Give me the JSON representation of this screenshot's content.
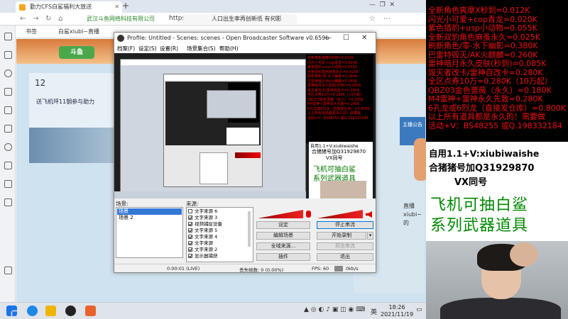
{
  "browser": {
    "tabs": [
      {
        "label": "勤力CFS白鲨福利大放送"
      },
      {
        "label": "武汉斗鱼网络科技有限公司"
      }
    ],
    "url": "https://ww",
    "address_prefix": "武汉斗鱼网络科技有限公司",
    "address_suffix": "人口出生率再创新低 有何影",
    "bookmarks": [
      "书签",
      "白鲨xiubi~直播",
      "白鲨xiubi~",
      "直播"
    ]
  },
  "page": {
    "logo": "斗鱼",
    "day": "12",
    "game_text": "送飞机坪11钢参与助力",
    "side_text": "直播 xiubi~ 的",
    "announcement": "主播公告"
  },
  "obs": {
    "title": "Profile: Untitled - Scenes: scenes - Open Broadcaster Software v0.659b",
    "menu": [
      "档案(F)",
      "设定(S)",
      "设置(R)",
      "场景集合(S)",
      "帮助(H)"
    ],
    "scenes_header": "场景:",
    "sources_header": "来源:",
    "scenes": [
      "场景",
      "场景 2"
    ],
    "sources": [
      {
        "label": "文字来源 6",
        "checked": false
      },
      {
        "label": "文字来源 3",
        "checked": true
      },
      {
        "label": "视频捕捉设备",
        "checked": true
      },
      {
        "label": "文字来源 5",
        "checked": true
      },
      {
        "label": "文字来源 4",
        "checked": true
      },
      {
        "label": "文字来源",
        "checked": true
      },
      {
        "label": "文字来源 2",
        "checked": true
      },
      {
        "label": "显示器捕获",
        "checked": true
      }
    ],
    "buttons": {
      "settings": "设定",
      "stop_stream": "停止串流",
      "edit_scene": "编辑场景",
      "start_record": "开始录制",
      "global_sources": "全域来源...",
      "preview_stream": "预览串流",
      "plugins": "插件",
      "exit": "退出"
    },
    "status": {
      "time": "0:00:01 (LIVE)",
      "dropped": "丢失帧数: 0 (0.00%)",
      "fps": "FPS: 60",
      "bitrate": "0kb/s"
    },
    "preview_text": {
      "line1": "自用1.1+V:xiubiwaishe",
      "line2": "合猪猪号加Q31929870",
      "line3": "VX同号",
      "line4": "飞机可抽白鲨",
      "line5": "系列武器道具"
    }
  },
  "taskbar": {
    "time": "18:26",
    "date": "2021/11/19",
    "lang": "英"
  },
  "overlay": {
    "red_lines": [
      "全新角色爽摩X秒到=0.012K",
      "闪光小可爱+cop青龙=0.020K",
      "紫色猎豹+usp小动物=0.055K",
      "全新双豹角色麻蚤永久=0.025K",
      "刷新角色/零-水下幽影=0.380K",
      "巴雷特毁灭/AK火麒麟=0.260K",
      "雷神暗月永久皮肤(秒到)=0.085K",
      "毁灭者改卡/雷神自改卡=0.280K",
      "全区点券10万=0.280K（10万起）",
      "QBZ03金色蔷薇（永久）=0.180K",
      "M4雷神+雷神永久先致=0.280K",
      "6孔龙或6烈龙（直接发仓库）=0.800K",
      "以上所有道具都是永久的！需要做",
      "活动+V：BS48255 或Q.198332184"
    ],
    "white_line1": "自用1.1+V:xiubiwaishe",
    "white_line2": "合猪猪号加Q31929870",
    "white_line3": "VX同号",
    "green_line1": "飞机可抽白鲨",
    "green_line2": "系列武器道具"
  }
}
